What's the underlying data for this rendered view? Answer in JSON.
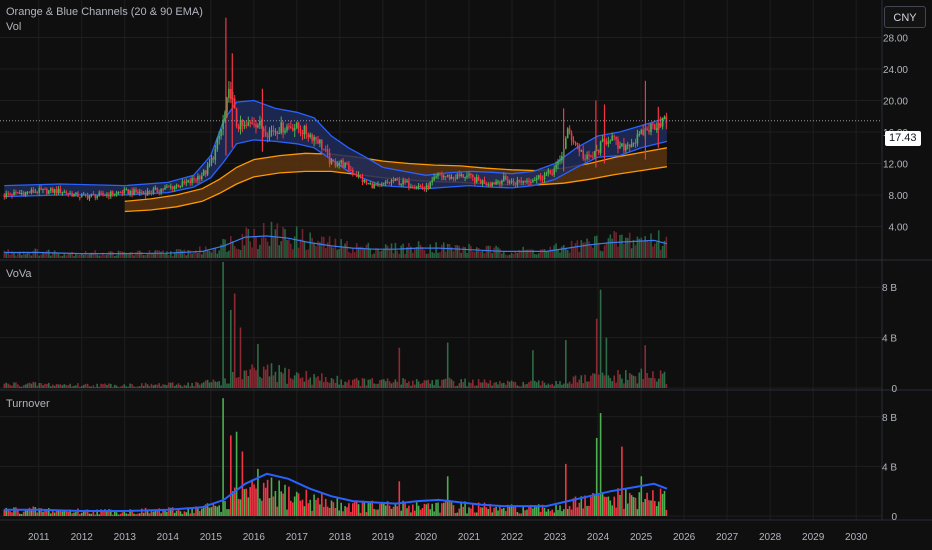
{
  "header": {
    "indicator_title": "Orange & Blue Channels (20 & 90 EMA)",
    "currency": "CNY"
  },
  "panes": {
    "price": {
      "label": "Vol"
    },
    "vova": {
      "label": "VoVa"
    },
    "turnover": {
      "label": "Turnover"
    }
  },
  "last_price": "17.43",
  "colors": {
    "up": "#4caf50",
    "down": "#f23645",
    "blue_line": "#2962ff",
    "blue_fill": "#1e2c5c",
    "orange_line": "#ff9800",
    "orange_fill": "#5a3410",
    "grid": "#1e1e1e",
    "background": "#0f0f0f"
  },
  "chart_data": [
    {
      "type": "candlestick",
      "title": "Orange & Blue Channels (20 & 90 EMA)",
      "ylim": [
        0,
        32
      ],
      "ytick_values": [
        4,
        8,
        12,
        16,
        20,
        24,
        28
      ],
      "ytick_labels": [
        "4.00",
        "8.00",
        "12.00",
        "16.00",
        "20.00",
        "24.00",
        "28.00"
      ],
      "x_labels": [
        "2011",
        "2012",
        "2013",
        "2014",
        "2015",
        "2016",
        "2017",
        "2018",
        "2019",
        "2020",
        "2021",
        "2022",
        "2023",
        "2024",
        "2025",
        "2026",
        "2027",
        "2028",
        "2029",
        "2030"
      ],
      "x_years": [
        2011,
        2012,
        2013,
        2014,
        2015,
        2016,
        2017,
        2018,
        2019,
        2020,
        2021,
        2022,
        2023,
        2024,
        2025,
        2026,
        2027,
        2028,
        2029,
        2030
      ],
      "xlim": [
        2010.1,
        2030.6
      ],
      "last_price": 17.43,
      "close_keyframes": {
        "t": [
          2010.2,
          2011.0,
          2011.5,
          2012.0,
          2012.5,
          2013.0,
          2013.5,
          2014.0,
          2014.5,
          2014.9,
          2015.1,
          2015.3,
          2015.45,
          2015.6,
          2015.8,
          2016.0,
          2016.3,
          2016.6,
          2016.9,
          2017.2,
          2017.5,
          2017.8,
          2018.0,
          2018.3,
          2018.6,
          2018.9,
          2019.2,
          2019.5,
          2019.8,
          2020.0,
          2020.3,
          2020.6,
          2020.9,
          2021.2,
          2021.5,
          2021.8,
          2022.0,
          2022.3,
          2022.6,
          2022.9,
          2023.1,
          2023.3,
          2023.5,
          2023.7,
          2023.9,
          2024.1,
          2024.3,
          2024.5,
          2024.7,
          2024.9,
          2025.1,
          2025.3,
          2025.5,
          2025.6
        ],
        "v": [
          8.0,
          8.5,
          8.5,
          7.8,
          8.0,
          8.4,
          8.3,
          8.9,
          9.6,
          11.0,
          13.5,
          17.5,
          21.5,
          17.0,
          16.5,
          17.5,
          16.0,
          16.5,
          16.8,
          16.0,
          15.0,
          12.0,
          12.2,
          11.0,
          9.5,
          9.0,
          9.8,
          9.5,
          9.2,
          8.8,
          10.5,
          10.2,
          10.5,
          9.8,
          9.5,
          10.0,
          9.6,
          9.8,
          10.2,
          10.8,
          12.0,
          16.0,
          14.5,
          12.5,
          13.0,
          14.5,
          15.5,
          13.8,
          14.5,
          15.0,
          16.2,
          16.8,
          17.5,
          17.4
        ]
      },
      "spikes": [
        {
          "t": 2015.35,
          "high": 30.5,
          "low": 13.0
        },
        {
          "t": 2015.5,
          "high": 26.0,
          "low": 14.0
        },
        {
          "t": 2016.2,
          "high": 21.5,
          "low": 13.5
        },
        {
          "t": 2023.2,
          "high": 19.0,
          "low": 11.0
        },
        {
          "t": 2023.95,
          "high": 20.0,
          "low": 11.5
        },
        {
          "t": 2024.15,
          "high": 19.5,
          "low": 12.0
        },
        {
          "t": 2025.1,
          "high": 22.5,
          "low": 12.5
        },
        {
          "t": 2025.4,
          "high": 19.2,
          "low": 14.0
        }
      ],
      "ema20": {
        "t": [
          2010.2,
          2011.5,
          2013.0,
          2014.0,
          2014.6,
          2015.0,
          2015.3,
          2015.6,
          2016.0,
          2016.5,
          2017.0,
          2017.4,
          2017.8,
          2018.2,
          2018.6,
          2019.0,
          2019.5,
          2020.0,
          2020.5,
          2021.0,
          2021.5,
          2022.0,
          2022.5,
          2023.0,
          2023.5,
          2024.0,
          2024.5,
          2025.0,
          2025.6
        ],
        "upper": [
          9.2,
          9.4,
          9.2,
          9.6,
          10.5,
          13.0,
          17.5,
          19.8,
          20.0,
          19.0,
          18.5,
          17.8,
          15.5,
          14.0,
          12.8,
          11.5,
          11.0,
          10.5,
          10.8,
          11.0,
          10.9,
          10.7,
          11.0,
          12.0,
          14.0,
          15.5,
          16.0,
          16.8,
          17.8
        ],
        "lower": [
          7.8,
          8.0,
          8.0,
          8.3,
          9.0,
          10.2,
          12.2,
          14.5,
          15.0,
          14.8,
          14.5,
          14.0,
          12.5,
          11.0,
          10.0,
          9.2,
          9.0,
          8.8,
          9.0,
          9.2,
          9.0,
          8.9,
          9.2,
          10.0,
          11.5,
          12.8,
          13.0,
          14.0,
          14.8
        ]
      },
      "ema90": {
        "t": [
          2013.0,
          2013.6,
          2014.2,
          2014.8,
          2015.2,
          2015.6,
          2016.0,
          2016.6,
          2017.2,
          2017.8,
          2018.4,
          2019.0,
          2019.6,
          2020.2,
          2020.8,
          2021.4,
          2022.0,
          2022.6,
          2023.2,
          2023.8,
          2024.4,
          2025.0,
          2025.6
        ],
        "upper": [
          7.2,
          7.5,
          8.0,
          8.8,
          10.0,
          11.5,
          12.5,
          13.0,
          13.3,
          13.2,
          12.8,
          12.3,
          12.0,
          11.8,
          11.7,
          11.4,
          11.2,
          11.1,
          11.4,
          12.0,
          12.8,
          13.4,
          14.0
        ],
        "lower": [
          5.9,
          6.1,
          6.5,
          7.2,
          8.2,
          9.4,
          10.3,
          10.8,
          11.0,
          11.0,
          10.6,
          10.2,
          9.9,
          9.7,
          9.6,
          9.4,
          9.3,
          9.3,
          9.5,
          10.0,
          10.6,
          11.1,
          11.6
        ]
      },
      "volume_ma": {
        "t": [
          2010.2,
          2011.0,
          2012.0,
          2013.0,
          2014.0,
          2014.8,
          2015.3,
          2015.8,
          2016.3,
          2016.8,
          2017.3,
          2017.8,
          2018.3,
          2018.8,
          2019.3,
          2019.8,
          2020.3,
          2020.8,
          2021.3,
          2021.8,
          2022.3,
          2022.8,
          2023.3,
          2023.8,
          2024.3,
          2024.8,
          2025.3,
          2025.6
        ],
        "v": [
          0.25,
          0.25,
          0.2,
          0.2,
          0.22,
          0.3,
          0.55,
          0.95,
          1.0,
          0.9,
          0.7,
          0.55,
          0.45,
          0.4,
          0.4,
          0.45,
          0.45,
          0.4,
          0.35,
          0.3,
          0.3,
          0.3,
          0.45,
          0.6,
          0.7,
          0.75,
          0.8,
          0.65
        ]
      }
    },
    {
      "type": "bar",
      "title": "VoVa",
      "ylim": [
        0,
        10
      ],
      "ytick_values": [
        0,
        4,
        8
      ],
      "ytick_labels": [
        "0",
        "4 B",
        "8 B"
      ],
      "unit": "B",
      "peaks": [
        {
          "t": 2015.3,
          "v": 10.0,
          "dir": "up"
        },
        {
          "t": 2015.45,
          "v": 6.2,
          "dir": "up"
        },
        {
          "t": 2015.55,
          "v": 7.5,
          "dir": "down"
        },
        {
          "t": 2015.7,
          "v": 4.8,
          "dir": "down"
        },
        {
          "t": 2016.1,
          "v": 3.5,
          "dir": "up"
        },
        {
          "t": 2019.4,
          "v": 3.2,
          "dir": "down"
        },
        {
          "t": 2020.5,
          "v": 3.6,
          "dir": "up"
        },
        {
          "t": 2022.5,
          "v": 3.0,
          "dir": "up"
        },
        {
          "t": 2023.25,
          "v": 3.8,
          "dir": "up"
        },
        {
          "t": 2023.95,
          "v": 5.5,
          "dir": "down"
        },
        {
          "t": 2024.05,
          "v": 7.8,
          "dir": "up"
        },
        {
          "t": 2024.2,
          "v": 4.0,
          "dir": "up"
        },
        {
          "t": 2025.1,
          "v": 3.4,
          "dir": "down"
        }
      ]
    },
    {
      "type": "bar",
      "title": "Turnover",
      "ylim": [
        0,
        10
      ],
      "ytick_values": [
        0,
        4,
        8
      ],
      "ytick_labels": [
        "0",
        "4 B",
        "8 B"
      ],
      "unit": "B",
      "peaks": [
        {
          "t": 2015.3,
          "v": 9.5,
          "dir": "up"
        },
        {
          "t": 2015.45,
          "v": 6.5,
          "dir": "down"
        },
        {
          "t": 2015.6,
          "v": 6.8,
          "dir": "up"
        },
        {
          "t": 2015.75,
          "v": 5.2,
          "dir": "down"
        },
        {
          "t": 2016.1,
          "v": 3.8,
          "dir": "up"
        },
        {
          "t": 2019.4,
          "v": 2.8,
          "dir": "down"
        },
        {
          "t": 2020.5,
          "v": 3.2,
          "dir": "up"
        },
        {
          "t": 2023.25,
          "v": 4.2,
          "dir": "down"
        },
        {
          "t": 2023.95,
          "v": 6.3,
          "dir": "up"
        },
        {
          "t": 2024.05,
          "v": 8.3,
          "dir": "up"
        },
        {
          "t": 2024.55,
          "v": 5.6,
          "dir": "down"
        },
        {
          "t": 2025.0,
          "v": 3.2,
          "dir": "up"
        }
      ],
      "ma": {
        "t": [
          2010.2,
          2011.0,
          2012.0,
          2013.0,
          2014.0,
          2014.8,
          2015.3,
          2015.8,
          2016.3,
          2016.8,
          2017.3,
          2017.8,
          2018.3,
          2018.8,
          2019.3,
          2019.8,
          2020.3,
          2020.8,
          2021.3,
          2021.8,
          2022.3,
          2022.8,
          2023.3,
          2023.8,
          2024.3,
          2024.8,
          2025.3,
          2025.6
        ],
        "v": [
          0.5,
          0.5,
          0.4,
          0.4,
          0.5,
          0.7,
          1.3,
          2.6,
          3.4,
          3.0,
          2.2,
          1.6,
          1.2,
          1.1,
          1.0,
          1.2,
          1.3,
          1.1,
          0.9,
          0.8,
          0.8,
          0.8,
          1.2,
          1.6,
          2.0,
          2.3,
          2.6,
          2.2
        ]
      }
    }
  ]
}
